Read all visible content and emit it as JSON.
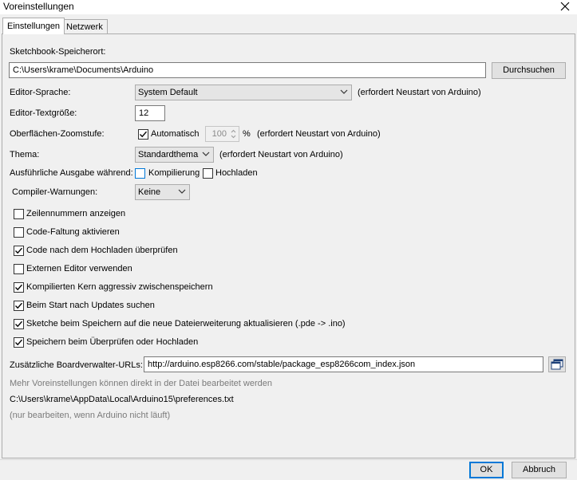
{
  "window": {
    "title": "Voreinstellungen"
  },
  "tabs": [
    {
      "label": "Einstellungen"
    },
    {
      "label": "Netzwerk"
    }
  ],
  "sketchbook": {
    "label": "Sketchbook-Speicherort:",
    "path": "C:\\Users\\krame\\Documents\\Arduino",
    "browse_label": "Durchsuchen"
  },
  "editor_language": {
    "label": "Editor-Sprache:",
    "value": "System Default",
    "note": "(erfordert Neustart von Arduino)"
  },
  "editor_font_size": {
    "label": "Editor-Textgröße:",
    "value": "12"
  },
  "zoom": {
    "label": "Oberflächen-Zoomstufe:",
    "auto_label": "Automatisch",
    "auto_checked": true,
    "value": "100",
    "unit": "%",
    "note": "(erfordert Neustart von Arduino)"
  },
  "theme": {
    "label": "Thema:",
    "value": "Standardthema",
    "note": "(erfordert Neustart von Arduino)"
  },
  "verbose": {
    "label": "Ausführliche Ausgabe während:",
    "compile_label": "Kompilierung",
    "compile_checked": false,
    "upload_label": "Hochladen",
    "upload_checked": false
  },
  "compiler_warnings": {
    "label": "Compiler-Warnungen:",
    "value": "Keine"
  },
  "options": [
    {
      "label": "Zeilennummern anzeigen",
      "checked": false
    },
    {
      "label": "Code-Faltung aktivieren",
      "checked": false
    },
    {
      "label": "Code nach dem Hochladen überprüfen",
      "checked": true
    },
    {
      "label": "Externen Editor verwenden",
      "checked": false
    },
    {
      "label": "Kompilierten Kern aggressiv zwischenspeichern",
      "checked": true
    },
    {
      "label": "Beim Start nach Updates suchen",
      "checked": true
    },
    {
      "label": "Sketche beim Speichern auf die neue Dateierweiterung aktualisieren (.pde -> .ino)",
      "checked": true
    },
    {
      "label": "Speichern beim Überprüfen oder Hochladen",
      "checked": true
    }
  ],
  "board_urls": {
    "label": "Zusätzliche Boardverwalter-URLs:",
    "value": "http://arduino.esp8266.com/stable/package_esp8266com_index.json",
    "icon": "window-list-icon"
  },
  "footer_info": {
    "more_text": "Mehr Voreinstellungen können direkt in der Datei bearbeitet werden",
    "prefs_path": "C:\\Users\\krame\\AppData\\Local\\Arduino15\\preferences.txt",
    "edit_hint": "(nur bearbeiten, wenn Arduino nicht läuft)"
  },
  "buttons": {
    "ok": "OK",
    "cancel": "Abbruch"
  },
  "colors": {
    "check_accent": "#0078d7",
    "window_bg": "#f0f0f0"
  }
}
